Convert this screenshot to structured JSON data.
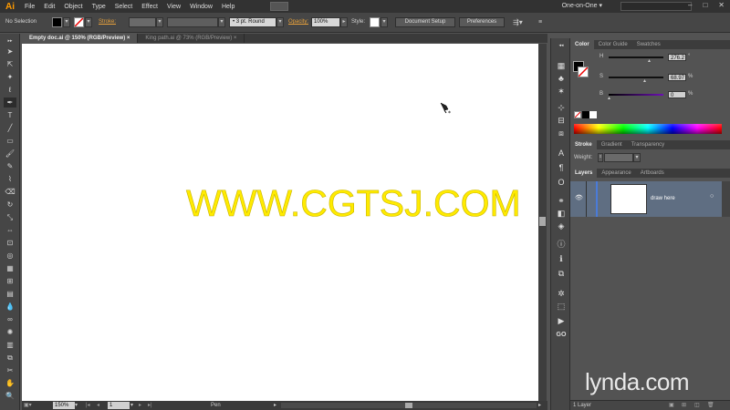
{
  "app": {
    "logo": "Ai"
  },
  "menu": [
    "File",
    "Edit",
    "Object",
    "Type",
    "Select",
    "Effect",
    "View",
    "Window",
    "Help"
  ],
  "workspace": {
    "label": "One-on-One",
    "dropdown_icon": "chevron-down-icon"
  },
  "window_controls": [
    "–",
    "□",
    "✕"
  ],
  "control_bar": {
    "selection_label": "No Selection",
    "stroke_label": "Stroke:",
    "stroke_profile": "3 pt. Round",
    "opacity_label": "Opacity:",
    "opacity_value": "100%",
    "style_label": "Style:",
    "document_setup": "Document Setup",
    "preferences": "Preferences"
  },
  "document_tabs": [
    {
      "label": "Empty doc.ai @ 150% (RGB/Preview)",
      "close": "×"
    },
    {
      "label": "King path.ai @ 73% (RGB/Preview)",
      "close": "×"
    }
  ],
  "canvas": {
    "watermark": "WWW.CGTSJ.COM"
  },
  "status_bar": {
    "zoom": "150%",
    "artboard": "1",
    "tool": "Pen"
  },
  "color_panel": {
    "tabs": [
      "Color",
      "Color Guide",
      "Swatches"
    ],
    "h_label": "H",
    "h_value": "276.2",
    "h_unit": "°",
    "s_label": "S",
    "s_value": "68.97",
    "s_unit": "%",
    "b_label": "B",
    "b_value": "0",
    "b_unit": "%"
  },
  "stroke_panel": {
    "tabs": [
      "Stroke",
      "Gradient",
      "Transparency"
    ],
    "weight_label": "Weight:"
  },
  "layers_panel": {
    "tabs": [
      "Layers",
      "Appearance",
      "Artboards"
    ],
    "layer_name": "draw here",
    "footer": "1 Layer"
  },
  "brand_watermark": "lynda.com",
  "colors": {
    "accent_orange": "#ff9a00",
    "watermark_yellow": "#ffeb00",
    "layer_selected": "#5f6e82",
    "layer_color_bar": "#4a7bd8"
  }
}
